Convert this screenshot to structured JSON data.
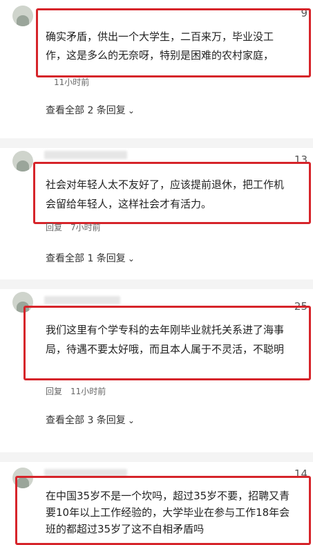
{
  "comments": [
    {
      "likes": "9",
      "lines": [
        "确实矛盾，供出一个大学生，二百来万，毕业没工",
        "作，这是多么的无奈呀，特别是困难的农村家庭，"
      ],
      "reply_label": "",
      "time": "11小时前",
      "view_replies": "查看全部 2 条回复"
    },
    {
      "likes": "13",
      "lines": [
        "社会对年轻人太不友好了，应该提前退休，把工作机",
        "会留给年轻人，这样社会才有活力。"
      ],
      "reply_label": "回复",
      "time": "7小时前",
      "view_replies": "查看全部 1 条回复"
    },
    {
      "likes": "25",
      "lines": [
        "我们这里有个学专科的去年刚毕业就托关系进了海事",
        "局，待遇不要太好哦，而且本人属于不灵活，不聪明"
      ],
      "reply_label": "回复",
      "time": "11小时前",
      "view_replies": "查看全部 3 条回复"
    },
    {
      "likes": "14",
      "lines": [
        "在中国35岁不是一个坎吗，超过35岁不要，招聘又青",
        "要10年以上工作经验的，大学毕业在参与工作18年会",
        "班的都超过35岁了这不自相矛盾吗"
      ],
      "reply_label": "",
      "time": "",
      "view_replies": ""
    }
  ],
  "colors": {
    "highlight_border": "#d6242a",
    "divider": "#f4f4f4"
  },
  "icons": {
    "expand": "chevron-down-icon"
  }
}
